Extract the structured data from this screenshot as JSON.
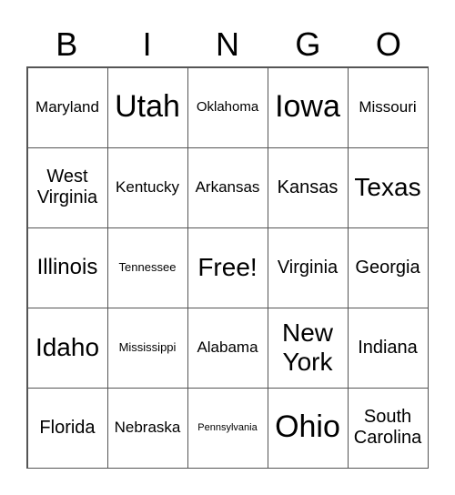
{
  "header": [
    "B",
    "I",
    "N",
    "G",
    "O"
  ],
  "cells": [
    [
      {
        "text": "Maryland",
        "size": "s-sm"
      },
      {
        "text": "Utah",
        "size": "s-xl"
      },
      {
        "text": "Oklahoma",
        "size": "s-xs"
      },
      {
        "text": "Iowa",
        "size": "s-xl"
      },
      {
        "text": "Missouri",
        "size": "s-sm"
      }
    ],
    [
      {
        "text": "West Virginia",
        "size": "s-m2"
      },
      {
        "text": "Kentucky",
        "size": "s-sm"
      },
      {
        "text": "Arkansas",
        "size": "s-sm"
      },
      {
        "text": "Kansas",
        "size": "s-m2"
      },
      {
        "text": "Texas",
        "size": "s-lg"
      }
    ],
    [
      {
        "text": "Illinois",
        "size": "s-md"
      },
      {
        "text": "Tennessee",
        "size": "s-xxs"
      },
      {
        "text": "Free!",
        "size": "s-lg"
      },
      {
        "text": "Virginia",
        "size": "s-m2"
      },
      {
        "text": "Georgia",
        "size": "s-m2"
      }
    ],
    [
      {
        "text": "Idaho",
        "size": "s-lg"
      },
      {
        "text": "Mississippi",
        "size": "s-xxs"
      },
      {
        "text": "Alabama",
        "size": "s-sm"
      },
      {
        "text": "New York",
        "size": "s-lg"
      },
      {
        "text": "Indiana",
        "size": "s-m2"
      }
    ],
    [
      {
        "text": "Florida",
        "size": "s-m2"
      },
      {
        "text": "Nebraska",
        "size": "s-sm"
      },
      {
        "text": "Pennsylvania",
        "size": "s-tiny"
      },
      {
        "text": "Ohio",
        "size": "s-xl"
      },
      {
        "text": "South Carolina",
        "size": "s-m2"
      }
    ]
  ]
}
